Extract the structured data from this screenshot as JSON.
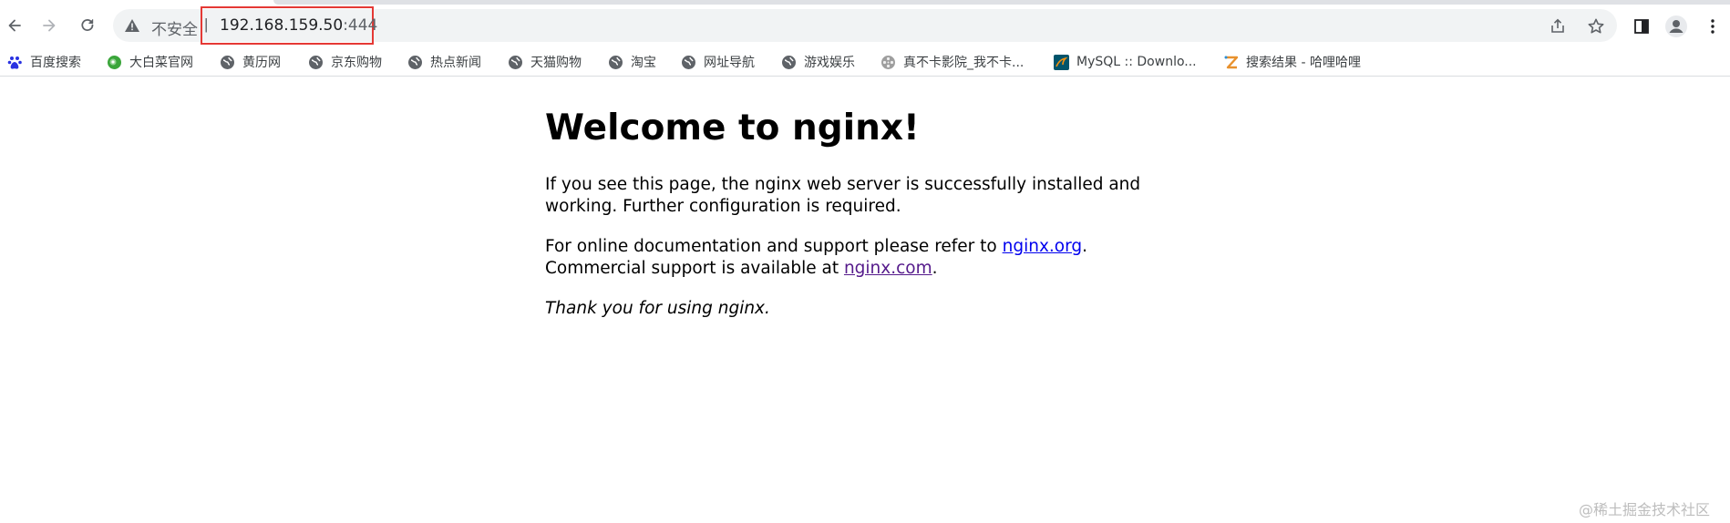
{
  "browser": {
    "security_label": "不安全",
    "separator": "|",
    "url_host": "192.168.159.50",
    "url_port": ":444",
    "highlight_color": "#e53935"
  },
  "bookmarks": [
    {
      "label": "百度搜索",
      "icon": "baidu-paw-icon"
    },
    {
      "label": "大白菜官网",
      "icon": "cabbage-icon"
    },
    {
      "label": "黄历网",
      "icon": "globe-icon"
    },
    {
      "label": "京东购物",
      "icon": "globe-icon"
    },
    {
      "label": "热点新闻",
      "icon": "globe-icon"
    },
    {
      "label": "天猫购物",
      "icon": "globe-icon"
    },
    {
      "label": "淘宝",
      "icon": "globe-icon"
    },
    {
      "label": "网址导航",
      "icon": "globe-icon"
    },
    {
      "label": "游戏娱乐",
      "icon": "globe-icon"
    },
    {
      "label": "真不卡影院_我不卡...",
      "icon": "film-reel-icon"
    },
    {
      "label": "MySQL :: Downlo...",
      "icon": "mysql-dolphin-icon"
    },
    {
      "label": "搜索结果 - 哈哩哈哩",
      "icon": "z-logo-icon"
    }
  ],
  "page": {
    "title": "Welcome to nginx!",
    "para1": "If you see this page, the nginx web server is successfully installed and working. Further configuration is required.",
    "para2_text1": "For online documentation and support please refer to ",
    "link_org": "nginx.org",
    "para2_text2": ".",
    "para2_text3": "Commercial support is available at ",
    "link_com": "nginx.com",
    "para2_text4": ".",
    "thanks": "Thank you for using nginx."
  },
  "watermark": "@稀土掘金技术社区"
}
